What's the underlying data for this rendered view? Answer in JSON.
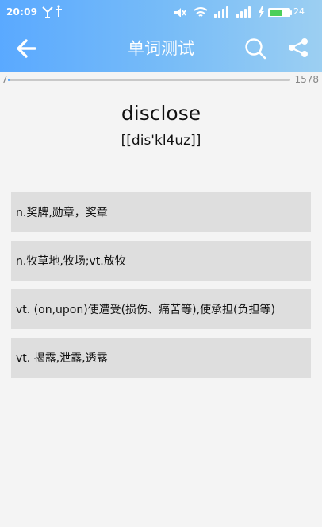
{
  "statusbar": {
    "time": "20:09",
    "battery": "24"
  },
  "header": {
    "title": "单词测试",
    "icons": {
      "back": "arrow-left-icon",
      "search": "search-icon",
      "share": "share-icon"
    }
  },
  "progress": {
    "current": "7",
    "total": "1578",
    "fraction": 0.0044
  },
  "word": {
    "text": "disclose",
    "phonetic": "[[dis'kl4uz]]"
  },
  "options": [
    "n.奖牌,勋章，奖章",
    "n.牧草地,牧场;vt.放牧",
    "vt. (on,upon)使遭受(损伤、痛苦等),使承担(负担等)",
    "vt. 揭露,泄露,透露"
  ],
  "colors": {
    "accent": "#5aa9ff",
    "option_bg": "#dedede",
    "background": "#f4f4f4"
  }
}
